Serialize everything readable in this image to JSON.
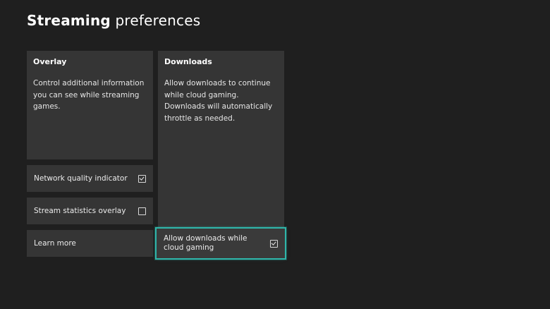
{
  "header": {
    "title_strong": "Streaming",
    "title_light": "preferences"
  },
  "overlay": {
    "title": "Overlay",
    "description": "Control additional information you can see while streaming games.",
    "network_quality": {
      "label": "Network quality indicator",
      "checked": true
    },
    "stream_stats": {
      "label": "Stream statistics overlay",
      "checked": false
    },
    "learn_more": "Learn more"
  },
  "downloads": {
    "title": "Downloads",
    "description": "Allow downloads to continue while cloud gaming. Downloads will automatically throttle as needed.",
    "allow_downloads": {
      "label": "Allow downloads while cloud gaming",
      "checked": true
    }
  },
  "colors": {
    "background": "#1f1f1f",
    "panel": "#353535",
    "focus_accent": "#2fb5a9"
  }
}
